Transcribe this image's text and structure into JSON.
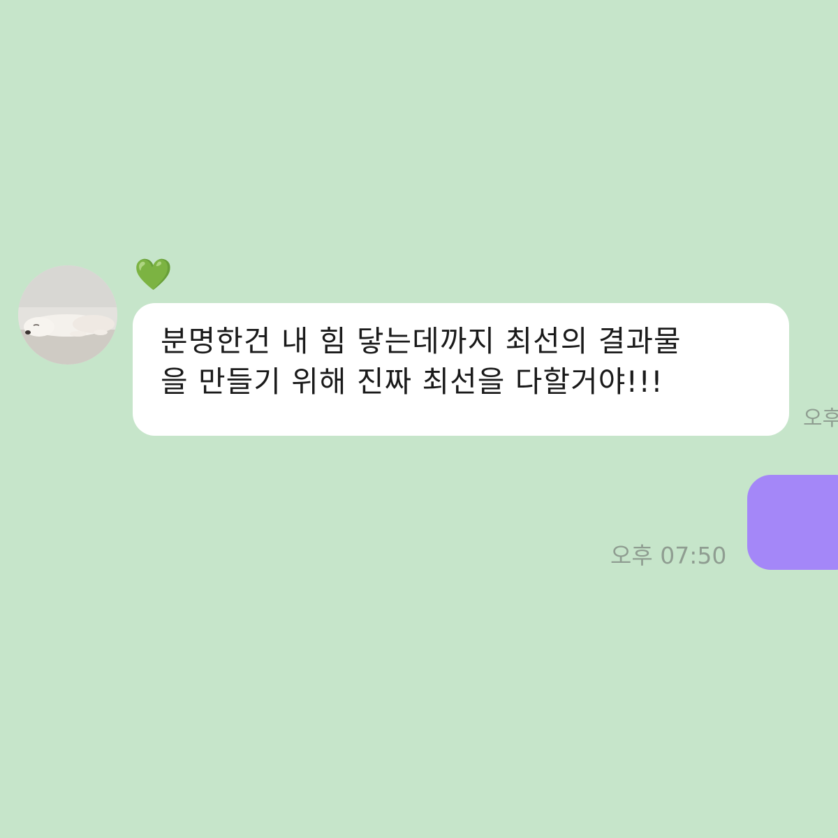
{
  "chat": {
    "incoming": {
      "sender_name": "💚",
      "avatar_icon": "sleeping-dog-photo",
      "message_lines": [
        "분명한건 내 힘 닿는데까지 최선의 결과물",
        "을 만들기 위해 진짜 최선을 다할거야!!!"
      ],
      "time": "오후"
    },
    "outgoing": {
      "time": "오후 07:50"
    }
  },
  "colors": {
    "background": "#c6e5ca",
    "incoming_bubble": "#ffffff",
    "outgoing_bubble": "#a487f8",
    "timestamp": "#8f9d91"
  }
}
